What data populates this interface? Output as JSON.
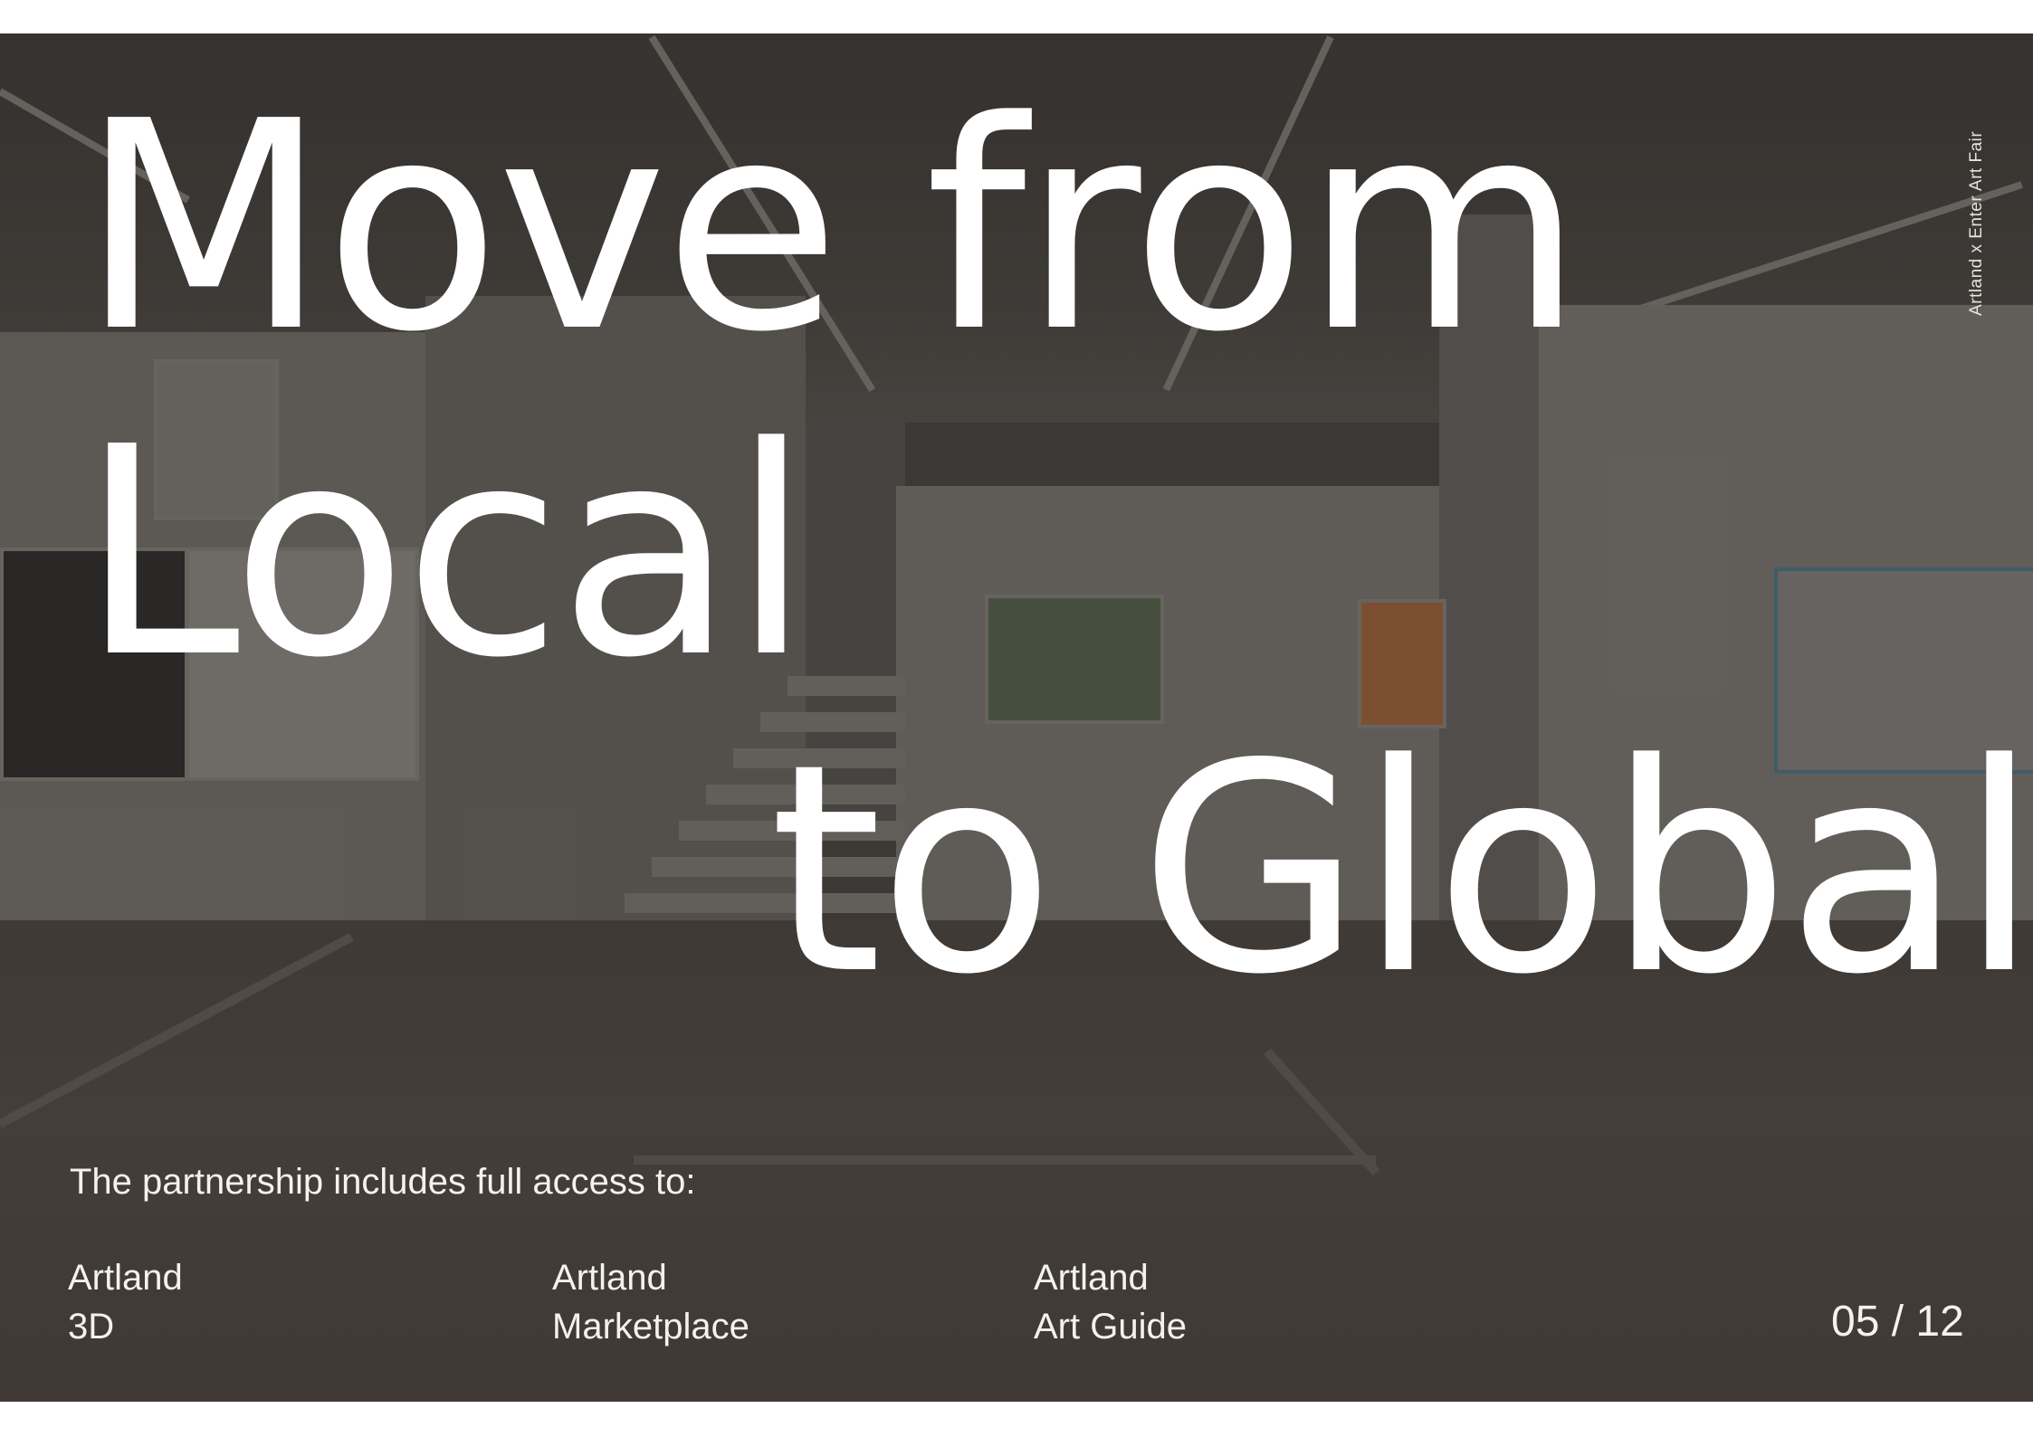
{
  "headline": {
    "line1": "Move from",
    "line2": "Local",
    "line3": "to Global"
  },
  "side_label": "Artland x Enter Art Fair",
  "intro": "The partnership includes full access to:",
  "products": [
    {
      "line1": "Artland",
      "line2": "3D"
    },
    {
      "line1": "Artland",
      "line2": "Marketplace"
    },
    {
      "line1": "Artland",
      "line2": "Art Guide"
    }
  ],
  "page_number": "05 / 12"
}
